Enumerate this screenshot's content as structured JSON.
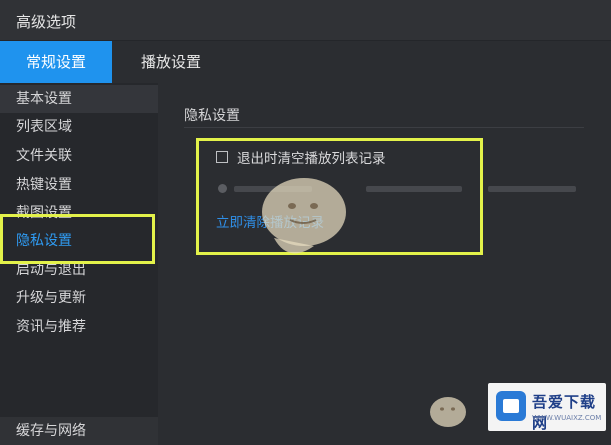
{
  "window": {
    "title": "高级选项"
  },
  "tabs": [
    {
      "label": "常规设置",
      "active": true
    },
    {
      "label": "播放设置",
      "active": false
    }
  ],
  "sidebar": {
    "items": [
      "基本设置",
      "列表区域",
      "文件关联",
      "热键设置",
      "截图设置",
      "隐私设置",
      "启动与退出",
      "升级与更新",
      "资讯与推荐"
    ],
    "active_index": 5,
    "bottom_item": "缓存与网络"
  },
  "privacy": {
    "section_title": "隐私设置",
    "clear_on_exit_label": "退出时清空播放列表记录",
    "clear_on_exit_checked": false,
    "clear_now_link": "立即清除播放记录"
  },
  "watermark": {
    "name": "吾爱下载网",
    "sub": "WWW.WUAIXZ.COM"
  },
  "colors": {
    "accent": "#1f93ee",
    "highlight": "#e3f24a",
    "link": "#2f8fe8"
  }
}
